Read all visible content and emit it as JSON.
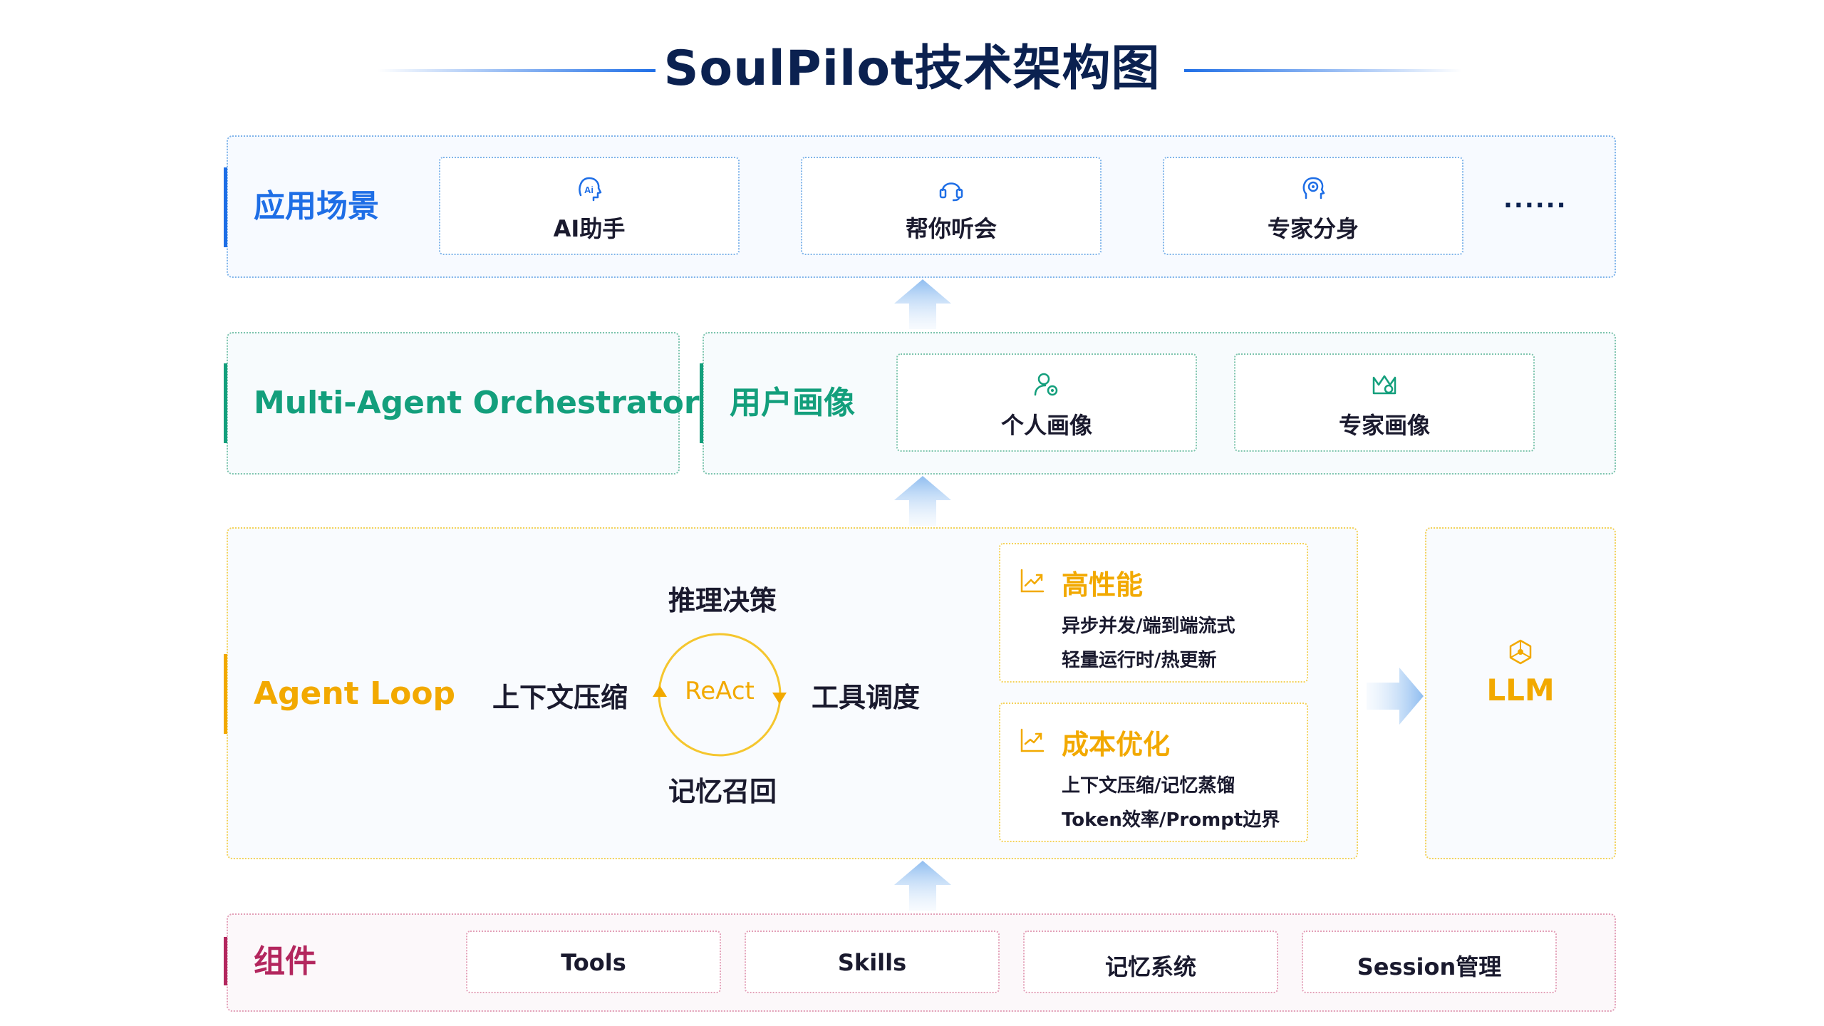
{
  "title": "SoulPilot技术架构图",
  "colors": {
    "blue": "#1e6ee6",
    "green": "#139f7c",
    "yellow": "#f2a900",
    "pink": "#b3275e",
    "navy": "#0b2150"
  },
  "scenes": {
    "label": "应用场景",
    "cards": [
      {
        "label": "AI助手",
        "icon": "ai-head-icon"
      },
      {
        "label": "帮你听会",
        "icon": "headset-icon"
      },
      {
        "label": "专家分身",
        "icon": "expert-head-icon"
      }
    ],
    "more": "......"
  },
  "orchestrator": {
    "label": "Multi-Agent Orchestrator"
  },
  "profile": {
    "label": "用户画像",
    "cards": [
      {
        "label": "个人画像",
        "icon": "user-gear-icon"
      },
      {
        "label": "专家画像",
        "icon": "crown-icon"
      }
    ]
  },
  "agent_loop": {
    "label": "Agent Loop",
    "center": "ReAct",
    "top": "推理决策",
    "bottom": "记忆召回",
    "left": "上下文压缩",
    "right": "工具调度",
    "features": [
      {
        "title": "高性能",
        "icon": "trend-up-icon",
        "lines": [
          "异步并发/端到端流式",
          "轻量运行时/热更新"
        ]
      },
      {
        "title": "成本优化",
        "icon": "trend-down-icon",
        "lines": [
          "上下文压缩/记忆蒸馏",
          "Token效率/Prompt边界"
        ]
      }
    ]
  },
  "llm": {
    "label": "LLM",
    "icon": "network-icon"
  },
  "components": {
    "label": "组件",
    "items": [
      "Tools",
      "Skills",
      "记忆系统",
      "Session管理"
    ]
  }
}
